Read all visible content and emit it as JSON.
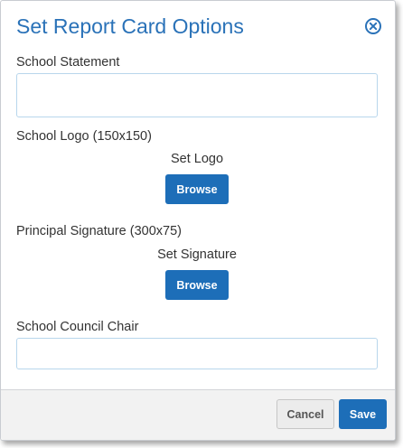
{
  "dialog": {
    "title": "Set Report Card Options",
    "close_icon": "close-circle-icon",
    "accent_color": "#2a72b8",
    "button_color": "#1d6eb8"
  },
  "fields": {
    "school_statement": {
      "label": "School Statement",
      "value": "",
      "placeholder": ""
    },
    "school_logo": {
      "label": "School Logo (150x150)",
      "status": "Set Logo",
      "button_label": "Browse"
    },
    "principal_signature": {
      "label": "Principal Signature (300x75)",
      "status": "Set Signature",
      "button_label": "Browse"
    },
    "school_council_chair": {
      "label": "School Council Chair",
      "value": "",
      "placeholder": ""
    }
  },
  "footer": {
    "cancel_label": "Cancel",
    "save_label": "Save"
  }
}
